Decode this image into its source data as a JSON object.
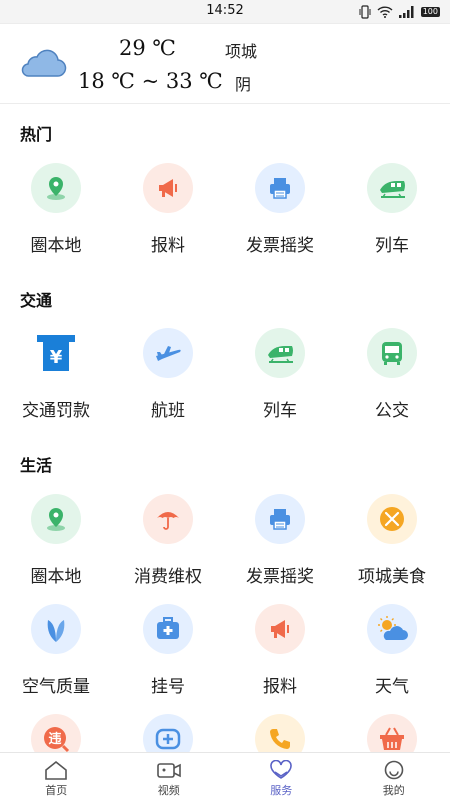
{
  "status_bar": {
    "time": "14:52",
    "battery": "100"
  },
  "weather": {
    "current_temp": "29 ℃",
    "temp_range": "18 ℃ ~ 33 ℃",
    "city": "项城",
    "condition": "阴",
    "icon": "cloud-icon"
  },
  "sections": {
    "hot": {
      "title": "热门",
      "items": [
        {
          "label": "圈本地",
          "icon": "map-pin-icon",
          "color": "#3bb36a"
        },
        {
          "label": "报料",
          "icon": "megaphone-icon",
          "color": "#f06a4a"
        },
        {
          "label": "发票摇奖",
          "icon": "printer-icon",
          "color": "#4a90e2"
        },
        {
          "label": "列车",
          "icon": "train-icon",
          "color": "#3bb36a"
        }
      ]
    },
    "traffic": {
      "title": "交通",
      "items": [
        {
          "label": "交通罚款",
          "icon": "fine-icon",
          "color": "#1a7fd8"
        },
        {
          "label": "航班",
          "icon": "plane-icon",
          "color": "#4a90e2"
        },
        {
          "label": "列车",
          "icon": "train-icon",
          "color": "#3bb36a"
        },
        {
          "label": "公交",
          "icon": "bus-icon",
          "color": "#3bb36a"
        }
      ]
    },
    "life": {
      "title": "生活",
      "items": [
        {
          "label": "圈本地",
          "icon": "map-pin-icon",
          "color": "#3bb36a"
        },
        {
          "label": "消费维权",
          "icon": "umbrella-icon",
          "color": "#f06a4a"
        },
        {
          "label": "发票摇奖",
          "icon": "printer-icon",
          "color": "#4a90e2"
        },
        {
          "label": "项城美食",
          "icon": "utensils-icon",
          "color": "#f5a623"
        },
        {
          "label": "空气质量",
          "icon": "leaf-icon",
          "color": "#4a90e2"
        },
        {
          "label": "挂号",
          "icon": "medical-kit-icon",
          "color": "#4a90e2"
        },
        {
          "label": "报料",
          "icon": "megaphone-icon",
          "color": "#f06a4a"
        },
        {
          "label": "天气",
          "icon": "weather-icon",
          "color": "#4a90e2"
        },
        {
          "label": "",
          "icon": "violation-icon",
          "color": "#f06a4a",
          "glyph": "违"
        },
        {
          "label": "",
          "icon": "health-icon",
          "color": "#4a90e2"
        },
        {
          "label": "",
          "icon": "phone-icon",
          "color": "#f5a623"
        },
        {
          "label": "",
          "icon": "basket-icon",
          "color": "#f06a4a"
        }
      ]
    }
  },
  "bottom_nav": [
    {
      "label": "首页",
      "icon": "home-icon"
    },
    {
      "label": "视频",
      "icon": "video-icon"
    },
    {
      "label": "服务",
      "icon": "service-heart-icon",
      "active": true
    },
    {
      "label": "我的",
      "icon": "profile-icon"
    }
  ],
  "colors": {
    "accent": "#5a62c6",
    "weather_cloud": "#8fb8e6"
  }
}
